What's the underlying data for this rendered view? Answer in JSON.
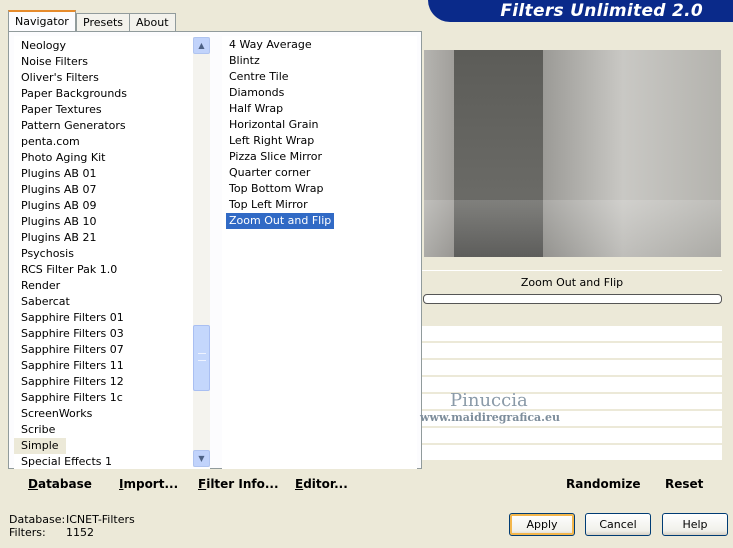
{
  "title": "Filters Unlimited 2.0",
  "tabs": [
    {
      "label": "Navigator",
      "active": true
    },
    {
      "label": "Presets",
      "active": false
    },
    {
      "label": "About",
      "active": false
    }
  ],
  "categories": [
    "Neology",
    "Noise Filters",
    "Oliver's Filters",
    "Paper Backgrounds",
    "Paper Textures",
    "Pattern Generators",
    "penta.com",
    "Photo Aging Kit",
    "Plugins AB 01",
    "Plugins AB 07",
    "Plugins AB 09",
    "Plugins AB 10",
    "Plugins AB 21",
    "Psychosis",
    "RCS Filter Pak 1.0",
    "Render",
    "Sabercat",
    "Sapphire Filters 01",
    "Sapphire Filters 03",
    "Sapphire Filters 07",
    "Sapphire Filters 11",
    "Sapphire Filters 12",
    "Sapphire Filters 1c",
    "ScreenWorks",
    "Scribe",
    "Simple",
    "Special Effects 1"
  ],
  "selected_category": "Simple",
  "filters": [
    "4 Way Average",
    "Blintz",
    "Centre Tile",
    "Diamonds",
    "Half Wrap",
    "Horizontal Grain",
    "Left Right Wrap",
    "Pizza Slice Mirror",
    "Quarter corner",
    "Top Bottom Wrap",
    "Top Left Mirror",
    "Zoom Out and Flip"
  ],
  "selected_filter": "Zoom Out and Flip",
  "preview": {
    "filter_name": "Zoom Out and Flip"
  },
  "watermark": {
    "name": "Pinuccia",
    "url": "www.maidiregrafica.eu"
  },
  "actions": {
    "database": {
      "u": "D",
      "rest": "atabase"
    },
    "import": {
      "u": "I",
      "rest": "mport..."
    },
    "filter_info": {
      "u": "F",
      "rest": "ilter Info..."
    },
    "editor": {
      "u": "E",
      "rest": "ditor..."
    },
    "randomize": "Randomize",
    "reset": "Reset"
  },
  "status": {
    "database_label": "Database:",
    "database_value": "ICNET-Filters",
    "filters_label": "Filters:",
    "filters_value": "1152"
  },
  "buttons": {
    "apply": "Apply",
    "cancel": "Cancel",
    "help": "Help"
  }
}
